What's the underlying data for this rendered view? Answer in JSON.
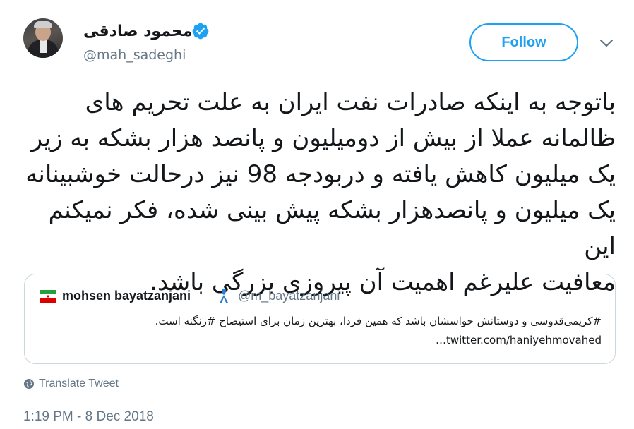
{
  "author": {
    "display_name": "محمود صادقی",
    "handle": "@mah_sadeghi",
    "verified": true
  },
  "follow_button": {
    "label": "Follow"
  },
  "tweet": {
    "text": "باتوجه به اینکه صادرات نفت ایران به علت تحریم های\nظالمانه عملا از بیش از دومیلیون و پانصد هزار بشکه به زیر\nیک میلیون کاهش یافته و دربودجه 98 نیز درحالت خوشبینانه\nیک میلیون و پانصدهزار بشکه پیش بینی شده، فکر نمیکنم این\nمعافیت علیرغم اهمیت آن پیروزی بزرگی باشد."
  },
  "quoted_tweet": {
    "display_name": "mohsen bayatzanjani",
    "handle": "@m_bayatzanjani",
    "text": "#کریمی‌قدوسی و دوستانش حواسشان باشد که همین فردا، بهترین زمان برای استیضاح #زنگنه است.\ntwitter.com/haniyehmovahed…",
    "flag_icon": "iran-flag-icon",
    "ribbon_icon": "blue-ribbon-icon"
  },
  "translate_label": "Translate Tweet",
  "timestamp": "1:19 PM - 8 Dec 2018",
  "colors": {
    "accent": "#1da1f2",
    "secondary_text": "#657786",
    "border": "#ccd6dd"
  }
}
